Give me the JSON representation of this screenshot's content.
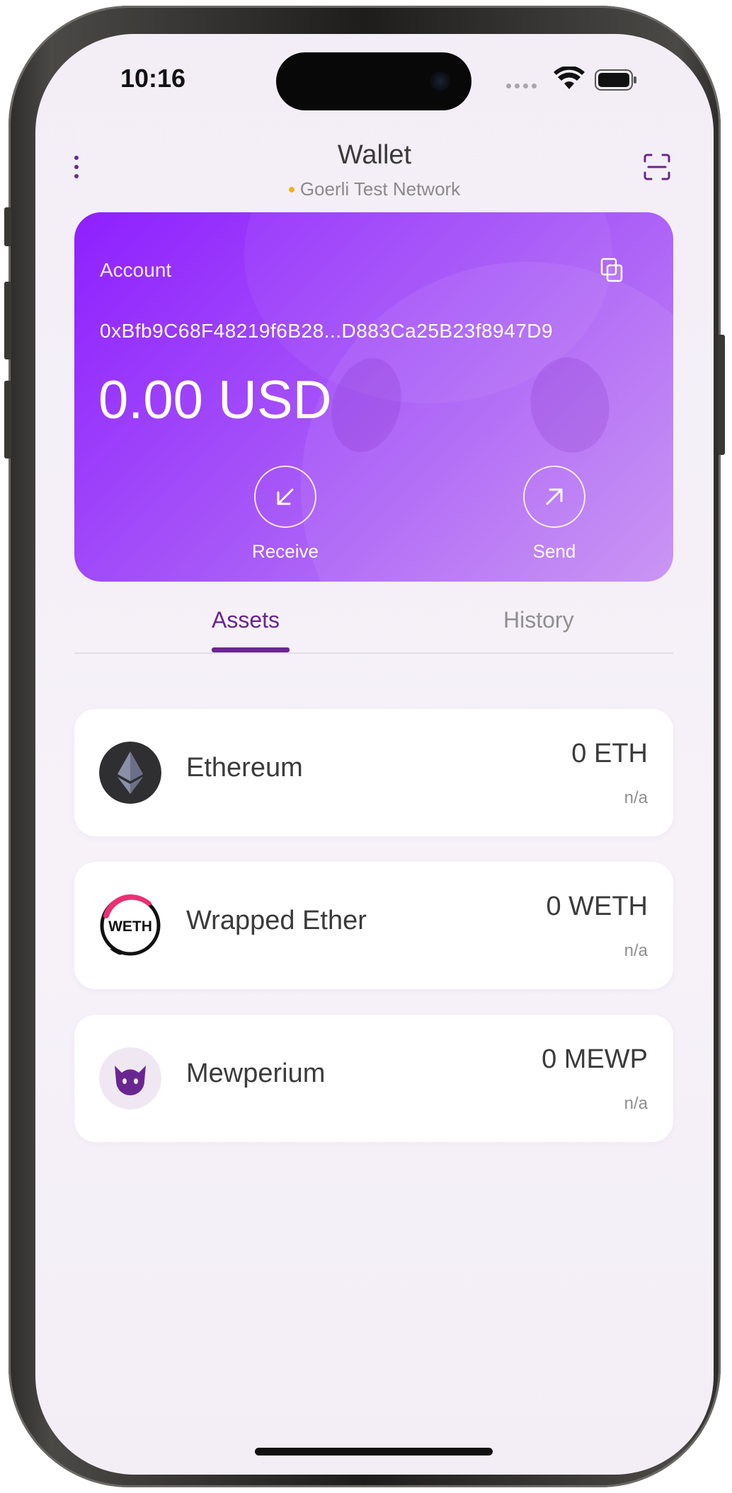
{
  "status_bar": {
    "time": "10:16"
  },
  "header": {
    "title": "Wallet",
    "network": "Goerli Test Network",
    "network_dot_color": "#f2b21a"
  },
  "account_card": {
    "label": "Account",
    "address": "0xBfb9C68F48219f6B28...D883Ca25B23f8947D9",
    "balance": "0.00 USD",
    "receive_label": "Receive",
    "send_label": "Send",
    "gradient_start": "#8e1fff",
    "gradient_end": "#c68ef3"
  },
  "tabs": [
    {
      "label": "Assets",
      "active": true
    },
    {
      "label": "History",
      "active": false
    }
  ],
  "assets": [
    {
      "name": "Ethereum",
      "amount": "0 ETH",
      "fiat": "n/a",
      "icon": "ethereum-icon"
    },
    {
      "name": "Wrapped Ether",
      "amount": "0 WETH",
      "fiat": "n/a",
      "icon": "weth-icon",
      "icon_text": "WETH"
    },
    {
      "name": "Mewperium",
      "amount": "0 MEWP",
      "fiat": "n/a",
      "icon": "mewperium-icon"
    }
  ],
  "accent_color": "#6a2690"
}
